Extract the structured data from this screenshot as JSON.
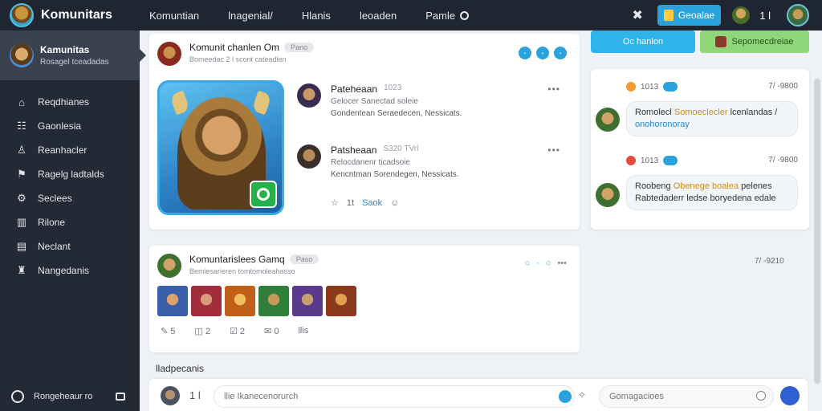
{
  "brand": {
    "name": "Komunitars"
  },
  "topnav": [
    {
      "label": "Komuntian"
    },
    {
      "label": "lnagenial/"
    },
    {
      "label": "Hlanis"
    },
    {
      "label": "leoaden"
    },
    {
      "label": "Pamle"
    }
  ],
  "top": {
    "create_label": "Geoalae",
    "count": "1 l"
  },
  "sidebar": {
    "profile_name": "Kamunitas",
    "profile_sub": "Rosagel tceadadas",
    "items": [
      {
        "label": "Reqdhianes"
      },
      {
        "label": "Gaonlesia"
      },
      {
        "label": "Reanhacler"
      },
      {
        "label": "Ragelg ladtalds"
      },
      {
        "label": "Seclees"
      },
      {
        "label": "Rilone"
      },
      {
        "label": "Neclant"
      },
      {
        "label": "Nangedanis"
      }
    ],
    "footer_label": "Rongeheaur ro"
  },
  "post": {
    "title": "Komunit chanlen Om",
    "chip": "Pano",
    "subtitle": "Bomeedac 2 l scont cateadlen",
    "comments": [
      {
        "name": "Pateheaan",
        "meta": "1023",
        "line1": "Gelocer Sanectad soleie",
        "line2": "Gondentean Seraedecen, Nessicats."
      },
      {
        "name": "Patsheaan",
        "meta": "S320 TVrl",
        "line1": "Relocdanenr ticadsoie",
        "line2": "Kencntman Sorendegen, Nessicats."
      }
    ],
    "action_count": "1t",
    "action_link": "Saok"
  },
  "game": {
    "title": "Komuntarislees Gamq",
    "chip": "Paso",
    "subtitle": "Bemiesarieren tomtomoleahasso",
    "counts": [
      "5",
      "2",
      "2",
      "0",
      "llis"
    ],
    "time": "7/ -9210"
  },
  "section_label": "lladpecanis",
  "right": {
    "btn_blue": "Oc hanlon",
    "btn_green": "Sepomecdreiae",
    "messages": [
      {
        "meta": "1013",
        "time": "7/ -9800",
        "text_a": "Romolecl ",
        "text_hl": "Somoeclecler",
        "text_b": " lcenlandas /",
        "text_bl": "onohoronoray"
      },
      {
        "meta": "1013",
        "time": "7/ -9800",
        "text_a": "Roobeng ",
        "text_hl": "Obenege boalea",
        "text_b": " pelenes Rabtedaderr ledse boryedena",
        "text_bl": "edale"
      }
    ]
  },
  "composer": {
    "count": "1 l",
    "placeholder": "llie Ikanecenorurch",
    "search_placeholder": "Gomagacioes"
  }
}
